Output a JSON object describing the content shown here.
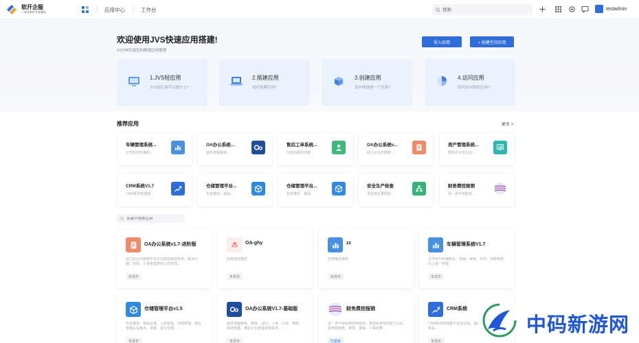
{
  "brand": {
    "name": "软开企服",
    "tagline": "一站式软件开发服务"
  },
  "nav": {
    "items": [
      "应用中心",
      "工作台"
    ]
  },
  "search": {
    "placeholder": "搜索"
  },
  "user": {
    "name": "testadmin"
  },
  "hero": {
    "title": "欢迎使用JVS快速应用搭建!",
    "subtitle": "10分钟完成您的数据应用管理",
    "import_label": "导入应用",
    "create_label": "+ 创建空白应用",
    "steps": [
      {
        "title": "1.JVS轻应用",
        "desc": "JVS轻应用可以做什么?",
        "icon": "monitor-icon"
      },
      {
        "title": "2.搭建应用",
        "desc": "如何搭建应用?",
        "icon": "laptop-icon"
      },
      {
        "title": "3.创建应用",
        "desc": "如何快速建一个应用?",
        "icon": "cubes-icon"
      },
      {
        "title": "4.访问应用",
        "desc": "如何访问我的应用?",
        "icon": "pie-icon"
      }
    ]
  },
  "recommended": {
    "title": "推荐应用",
    "more_label": "更多 >",
    "items": [
      {
        "name": "车辆管理系统...",
        "desc": "公司针对车辆的...",
        "icon": "bar-chart-icon",
        "color": "#4a90e2"
      },
      {
        "name": "OA办公系统...",
        "desc": "提供流程审批...",
        "icon": "oa-icon",
        "color": "#1e4e9c"
      },
      {
        "name": "售后工单系统...",
        "desc": "为售后服务流量...",
        "icon": "person-icon",
        "color": "#3dbb7c"
      },
      {
        "name": "OA办公系统v...",
        "desc": "助力企业内部数...",
        "icon": "document-icon",
        "color": "#ef8a6a"
      },
      {
        "name": "资产管理系统...",
        "desc": "帮助中大型企业...",
        "icon": "presentation-icon",
        "color": "#2eb7b0"
      },
      {
        "name": "CRM系统V1.7",
        "desc": "CRM系统管理客...",
        "icon": "trend-icon",
        "color": "#2f6ddc"
      },
      {
        "name": "仓储管理平台...",
        "desc": "包含模块：基础...",
        "icon": "box-icon",
        "color": "#2f8ae0"
      },
      {
        "name": "仓储管理平台...",
        "desc": "包含模块：基础...",
        "icon": "box-icon",
        "color": "#2f8ae0"
      },
      {
        "name": "安全生产检查",
        "desc": "本应用主要帮助...",
        "icon": "org-icon",
        "color": "#36b27a"
      },
      {
        "name": "财务费控报销",
        "desc": "进一步升级服务...",
        "icon": "globe-icon",
        "color": "#8e6ad8"
      }
    ]
  },
  "filter": {
    "placeholder": "关键字搜索应用"
  },
  "apps": [
    {
      "name": "OA办公系统v1.7-进阶版",
      "desc": "助力企业内部数字化办公能效最佳系统，解决问题、时效、人事管理类的公司管理...",
      "badge": "未发布",
      "published": false,
      "icon": "document-icon",
      "color": "#ef8a6a"
    },
    {
      "name": "OA-ghy",
      "desc": "应用描述描述",
      "badge": "未发布",
      "published": false,
      "icon": "flower-icon",
      "color": "#f06a6a"
    },
    {
      "name": "zz",
      "desc": "应用描述描述",
      "badge": "未发布",
      "published": false,
      "icon": "bar-chart-icon",
      "color": "#4a90e2"
    },
    {
      "name": "车辆管理系统V1.7",
      "desc": "公司针对车辆用车、加油、维保、年检、违章等进行上报一览理",
      "badge": "未发布",
      "published": false,
      "icon": "bar-chart-icon",
      "color": "#4a90e2"
    },
    {
      "name": "仓储管理平台v1.5",
      "desc": "包含模块：基础设置、入库管理、出库管理、库位管理以及盘点、调拨、盈亏处理...",
      "badge": "未发布",
      "published": false,
      "icon": "box-icon",
      "color": "#2f8ae0"
    },
    {
      "name": "OA办公系统V1.7-基础版",
      "desc": "提供流程审批、审批、合同、人事、行政、档案、绩效管理，满足企业管理发展需求...",
      "badge": "未发布",
      "published": false,
      "icon": "oa-icon",
      "color": "#1e4e9c"
    },
    {
      "name": "财务费控报销",
      "desc": "进一步升级费用控制规则，帮助财务费控能力以及费用控制度、审批、报销、人事结算...",
      "badge": "已发布",
      "published": true,
      "icon": "globe-icon",
      "color": "#8e6ad8"
    },
    {
      "name": "CRM系统",
      "desc": "CRM系统管理客户的全过程，服务跟踪信息，销售机会...",
      "badge": "未发布",
      "published": false,
      "icon": "trend-icon",
      "color": "#2f6ddc"
    }
  ],
  "watermark": {
    "text": "中码新游网"
  }
}
